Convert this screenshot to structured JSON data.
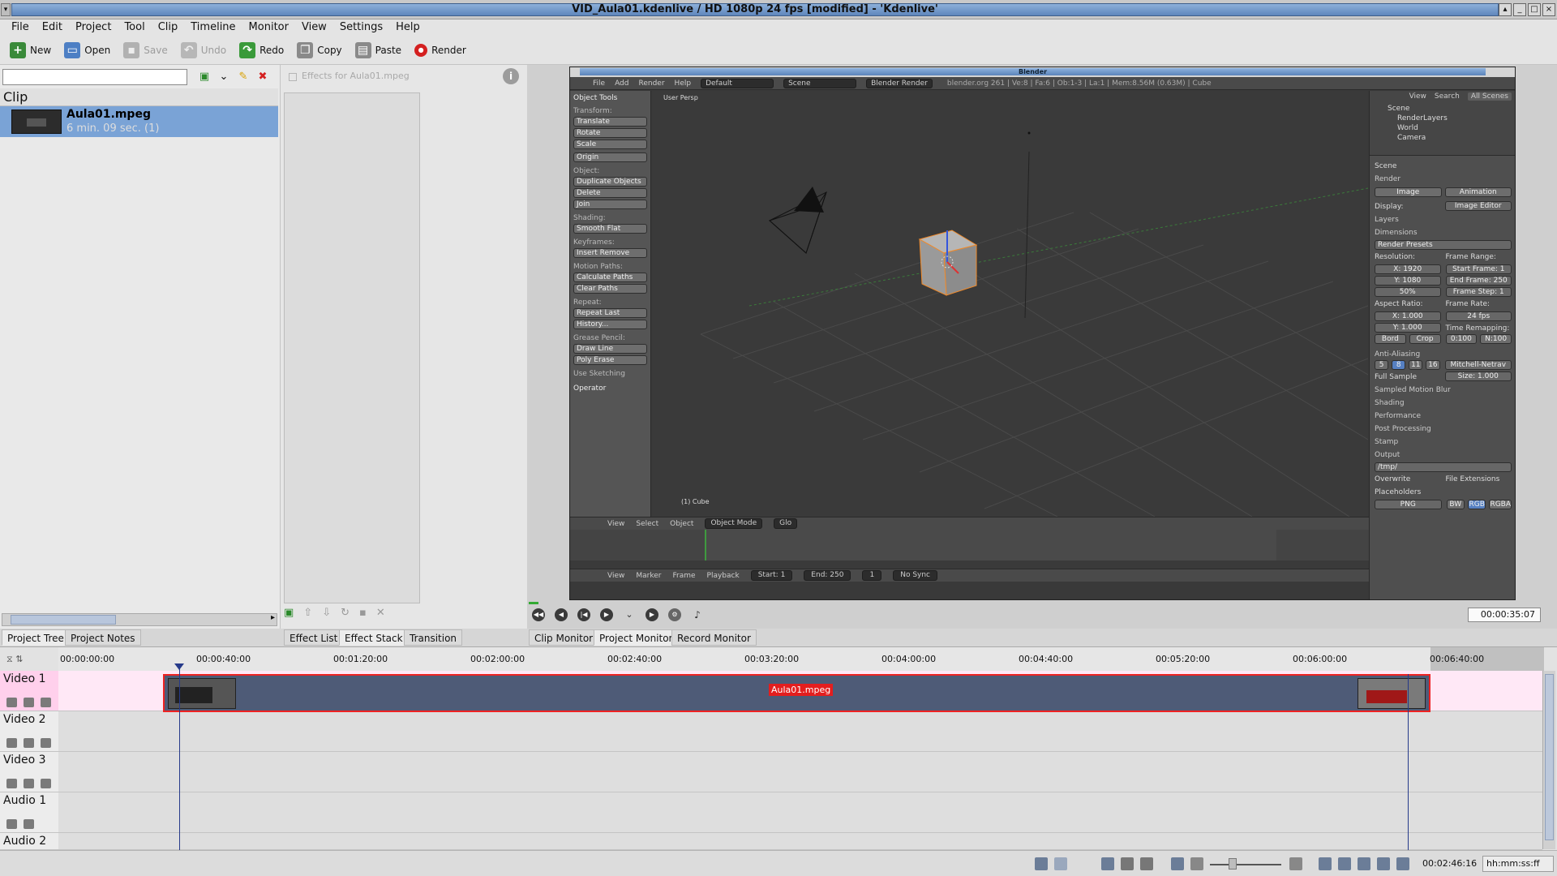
{
  "window": {
    "title": "VID_Aula01.kdenlive / HD 1080p 24 fps [modified] - 'Kdenlive'"
  },
  "menu": [
    "File",
    "Edit",
    "Project",
    "Tool",
    "Clip",
    "Timeline",
    "Monitor",
    "View",
    "Settings",
    "Help"
  ],
  "toolbar": {
    "new": "New",
    "open": "Open",
    "save": "Save",
    "undo": "Undo",
    "redo": "Redo",
    "copy": "Copy",
    "paste": "Paste",
    "render": "Render"
  },
  "project": {
    "search_value": "",
    "column_header": "Clip",
    "clips": [
      {
        "name": "Aula01.mpeg",
        "duration": "6 min. 09 sec. (1)"
      }
    ]
  },
  "effect_stack": {
    "label": "Effects for Aula01.mpeg"
  },
  "blender": {
    "title": "Blender",
    "menu": [
      "File",
      "Add",
      "Render",
      "Help"
    ],
    "layout": "Default",
    "scene": "Scene",
    "engine": "Blender Render",
    "stats": "blender.org 261 | Ve:8 | Fa:6 | Ob:1-3 | La:1 | Mem:8.56M (0.63M) | Cube",
    "viewport_label": "User Persp",
    "object_label": "(1) Cube",
    "tools": {
      "header": "Object Tools",
      "sections": [
        {
          "title": "Transform:",
          "buttons": [
            "Translate",
            "Rotate",
            "Scale"
          ]
        },
        {
          "title": "",
          "buttons": [
            "Origin"
          ]
        },
        {
          "title": "Object:",
          "buttons": [
            "Duplicate Objects",
            "Delete",
            "Join"
          ]
        },
        {
          "title": "Shading:",
          "buttons": [
            "Smooth   Flat"
          ]
        },
        {
          "title": "Keyframes:",
          "buttons": [
            "Insert     Remove"
          ]
        },
        {
          "title": "Motion Paths:",
          "buttons": [
            "Calculate Paths",
            "Clear Paths"
          ]
        },
        {
          "title": "Repeat:",
          "buttons": [
            "Repeat Last",
            "History..."
          ]
        },
        {
          "title": "Grease Pencil:",
          "buttons": [
            "Draw       Line",
            "Poly       Erase"
          ]
        }
      ],
      "use_sketching": "Use Sketching",
      "operator": "Operator"
    },
    "outliner": {
      "view": "View",
      "search": "Search",
      "all_scenes": "All Scenes",
      "items": [
        "Scene",
        "RenderLayers",
        "World",
        "Camera"
      ]
    },
    "props": {
      "scene": "Scene",
      "render": "Render",
      "image": "Image",
      "animation": "Animation",
      "display_label": "Display:",
      "display_value": "Image Editor",
      "layers": "Layers",
      "dimensions": "Dimensions",
      "presets": "Render Presets",
      "resolution": "Resolution:",
      "res_x": "X: 1920",
      "res_y": "Y: 1080",
      "res_pct": "50%",
      "frame_range": "Frame Range:",
      "start_frame": "Start Frame: 1",
      "end_frame": "End Frame: 250",
      "frame_step": "Frame Step: 1",
      "aspect": "Aspect Ratio:",
      "aspect_x": "X: 1.000",
      "aspect_y": "Y: 1.000",
      "frame_rate": "Frame Rate:",
      "fps": "24 fps",
      "time_remap": "Time Remapping:",
      "remap_old": "0:100",
      "remap_new": "N:100",
      "border": "Bord",
      "crop": "Crop",
      "anti_aliasing": "Anti-Aliasing",
      "aa_levels": [
        "5",
        "8",
        "11",
        "16"
      ],
      "aa_filter": "Mitchell-Netrav",
      "full_sample": "Full Sample",
      "size": "Size: 1.000",
      "sampled_motion_blur": "Sampled Motion Blur",
      "shading": "Shading",
      "performance": "Performance",
      "post_processing": "Post Processing",
      "stamp": "Stamp",
      "output": "Output",
      "output_path": "/tmp/",
      "overwrite": "Overwrite",
      "file_extensions": "File Extensions",
      "placeholders": "Placeholders",
      "format": "PNG",
      "bw": "BW",
      "rgb": "RGB",
      "rgba": "RGBA"
    },
    "viewport_header": {
      "view": "View",
      "select": "Select",
      "object": "Object",
      "mode": "Object Mode",
      "pivot": "Glo"
    },
    "timeline_header": {
      "view": "View",
      "marker": "Marker",
      "frame": "Frame",
      "playback": "Playback",
      "start": "Start: 1",
      "end": "End: 250",
      "current": "1",
      "sync": "No Sync"
    }
  },
  "monitor": {
    "timecode": "00:00:35:07"
  },
  "tabs": {
    "project_tree": "Project Tree",
    "project_notes": "Project Notes",
    "effect_list": "Effect List",
    "effect_stack": "Effect Stack",
    "transition": "Transition",
    "clip_monitor": "Clip Monitor",
    "project_monitor": "Project Monitor",
    "record_monitor": "Record Monitor"
  },
  "timeline": {
    "ruler": [
      "00:00:00:00",
      "00:00:40:00",
      "00:01:20:00",
      "00:02:00:00",
      "00:02:40:00",
      "00:03:20:00",
      "00:04:00:00",
      "00:04:40:00",
      "00:05:20:00",
      "00:06:00:00",
      "00:06:40:00"
    ],
    "tracks": [
      "Video 1",
      "Video 2",
      "Video 3",
      "Audio 1",
      "Audio 2"
    ],
    "clip_label": "Aula01.mpeg"
  },
  "status": {
    "timecode": "00:02:46:16",
    "format": "hh:mm:ss:ff"
  }
}
